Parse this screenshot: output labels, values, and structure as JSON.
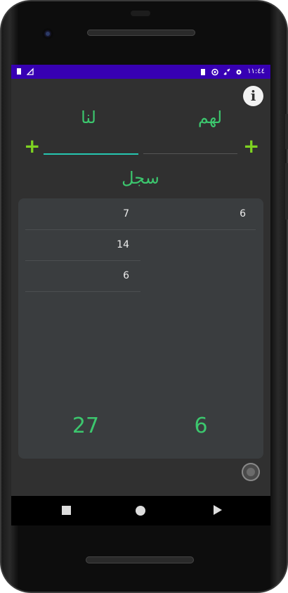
{
  "status_bar": {
    "time": "١١:٤٤",
    "left_icons": [
      "battery-icon",
      "signal-icon"
    ],
    "right_icons": [
      "sd-card-icon",
      "sync-icon",
      "wifi-icon",
      "settings-icon"
    ],
    "color": "#3700b3"
  },
  "header": {
    "info_label": "i"
  },
  "teams": {
    "us": {
      "label": "لنا",
      "add_label": "+",
      "input_value": ""
    },
    "them": {
      "label": "لهم",
      "add_label": "+",
      "input_value": ""
    }
  },
  "record_label": "سجل",
  "scores": {
    "us": [
      "7",
      "14",
      "6"
    ],
    "them": [
      "6"
    ]
  },
  "totals": {
    "us": "27",
    "them": "6"
  },
  "colors": {
    "accent_green": "#3cc76e",
    "plus_green": "#7ed321",
    "input_underline": "#26c6b0",
    "background": "#303030",
    "card": "#3a3d3f"
  },
  "navigation": [
    "back-button",
    "home-button",
    "recents-button"
  ]
}
